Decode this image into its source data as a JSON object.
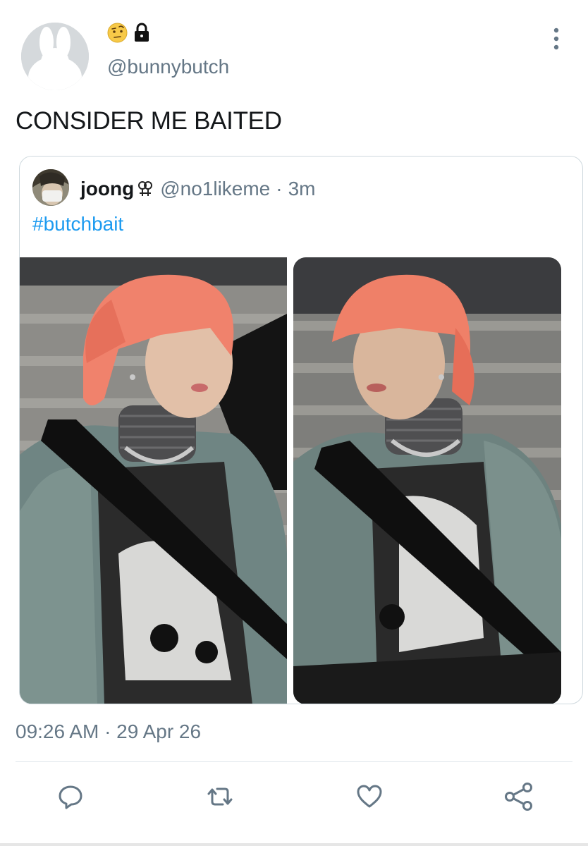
{
  "author": {
    "handle": "@bunnybutch",
    "avatar": "bunny-avatar-icon",
    "status_icons": [
      "raised-eyebrow-face-icon",
      "lock-icon"
    ]
  },
  "tweet": {
    "text": "CONSIDER ME BAITED",
    "timestamp": "09:26 AM · 29 Apr 26"
  },
  "quoted_tweet": {
    "display_name": "joong",
    "badge_icon": "double-female-sign-icon",
    "handle": "@no1likeme",
    "separator": "·",
    "time_ago": "3m",
    "hashtag": "#butchbait",
    "photos": [
      "photo-left",
      "photo-right"
    ]
  },
  "actions": [
    {
      "name": "reply-icon"
    },
    {
      "name": "retweet-icon"
    },
    {
      "name": "like-icon"
    },
    {
      "name": "share-icon"
    }
  ],
  "colors": {
    "link": "#1d9bf0",
    "muted": "#657786",
    "text": "#14171a",
    "border": "#cfd9de"
  }
}
